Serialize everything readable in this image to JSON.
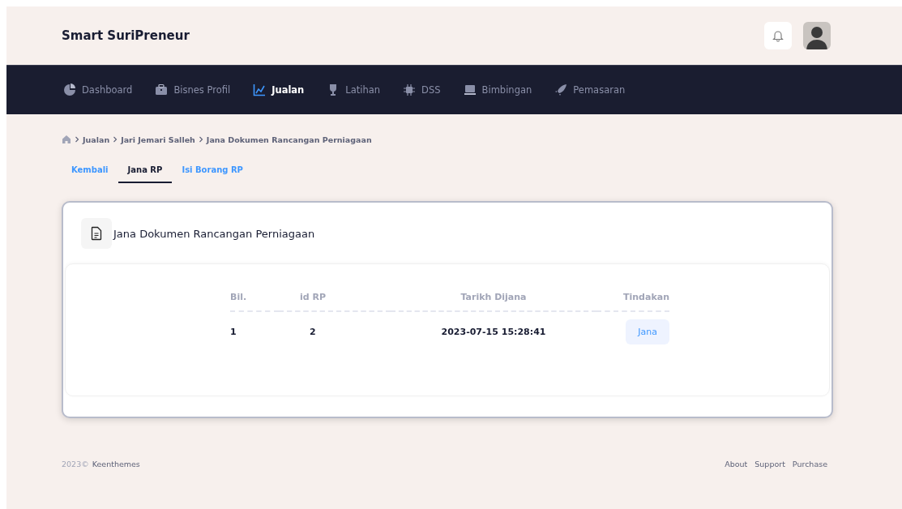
{
  "header": {
    "brand": "Smart SuriPreneur"
  },
  "nav": [
    {
      "label": "Dashboard",
      "kind": "pie",
      "selected": false
    },
    {
      "label": "Bisnes Profil",
      "kind": "briefcase",
      "selected": false
    },
    {
      "label": "Jualan",
      "kind": "chart",
      "selected": true
    },
    {
      "label": "Latihan",
      "kind": "trophy",
      "selected": false
    },
    {
      "label": "DSS",
      "kind": "chip",
      "selected": false
    },
    {
      "label": "Bimbingan",
      "kind": "board",
      "selected": false
    },
    {
      "label": "Pemasaran",
      "kind": "rocket",
      "selected": false
    }
  ],
  "breadcrumb": [
    "Jualan",
    "Jari Jemari Salleh",
    "Jana Dokumen Rancangan Perniagaan"
  ],
  "tabs": [
    {
      "label": "Kembali",
      "selected": false
    },
    {
      "label": "Jana RP",
      "selected": true
    },
    {
      "label": "Isi Borang RP",
      "selected": false
    }
  ],
  "card": {
    "title": "Jana Dokumen Rancangan Perniagaan",
    "table": {
      "columns": [
        "Bil.",
        "id RP",
        "Tarikh Dijana",
        "Tindakan"
      ],
      "rows": [
        {
          "bil": "1",
          "id": "2",
          "date": "2023-07-15 15:28:41",
          "action": "Jana"
        }
      ]
    }
  },
  "footer": {
    "year": "2023©",
    "company": "Keenthemes",
    "links": [
      "About",
      "Support",
      "Purchase"
    ]
  }
}
